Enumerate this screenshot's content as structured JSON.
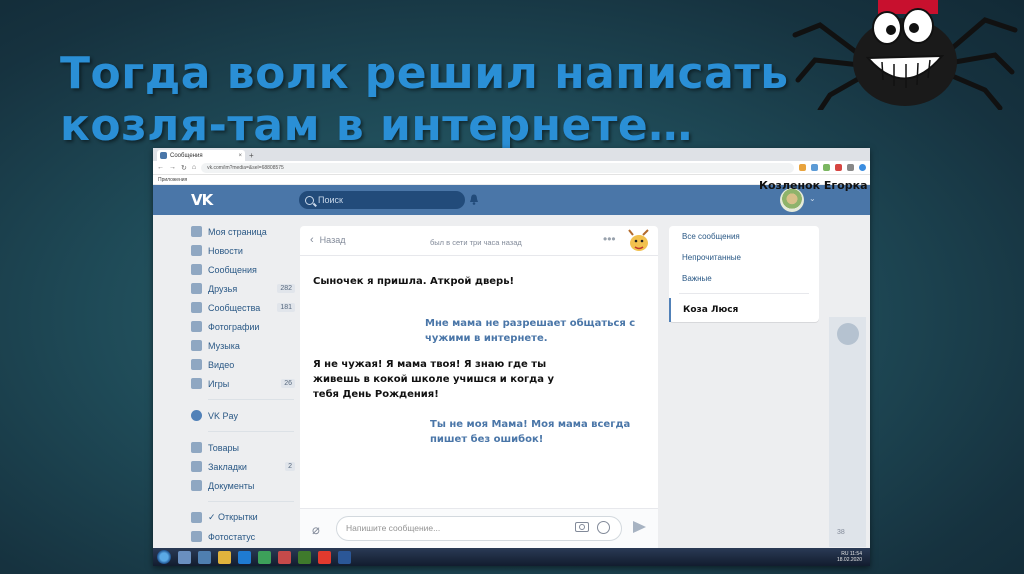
{
  "slide": {
    "title": "Тогда волк решил написать козля-там в интернете…"
  },
  "browser": {
    "tab_title": "Сообщения",
    "tab_close": "×",
    "new_tab": "+",
    "url": "vk.com/im?media=&sel=68808575",
    "bookmark": "Приложения"
  },
  "vk": {
    "logo": "VK",
    "search_placeholder": "Поиск",
    "user_name": "Козленок Егорка",
    "sidebar": [
      {
        "label": "Моя страница",
        "count": ""
      },
      {
        "label": "Новости",
        "count": ""
      },
      {
        "label": "Сообщения",
        "count": ""
      },
      {
        "label": "Друзья",
        "count": "282"
      },
      {
        "label": "Сообщества",
        "count": "181"
      },
      {
        "label": "Фотографии",
        "count": ""
      },
      {
        "label": "Музыка",
        "count": ""
      },
      {
        "label": "Видео",
        "count": ""
      },
      {
        "label": "Игры",
        "count": "26"
      }
    ],
    "sidebar_pay": {
      "label": "VK Pay"
    },
    "sidebar_extra": [
      {
        "label": "Товары",
        "count": ""
      },
      {
        "label": "Закладки",
        "count": "2"
      },
      {
        "label": "Документы",
        "count": ""
      }
    ],
    "sidebar_bottom": [
      {
        "label": "✓ Открытки"
      },
      {
        "label": "Фотостатус"
      }
    ],
    "chat": {
      "back_label": "Назад",
      "last_seen": "был в сети три часа назад",
      "more": "•••",
      "messages": [
        {
          "dir": "in",
          "text": "Сыночек я пришла.  Аткрой дверь!"
        },
        {
          "dir": "out",
          "text": "Мне мама не разрешает общаться с\nчужими в интернете."
        },
        {
          "dir": "in",
          "text": "Я не чужая! Я мама твоя! Я знаю где ты\nживешь в кокой школе учишся   и когда у\nтебя День Рождения!"
        },
        {
          "dir": "out",
          "text": "Ты не моя Мама! Моя мама всегда\nпишет без ошибок!"
        }
      ],
      "input_placeholder": "Напишите сообщение..."
    },
    "filters": {
      "items": [
        "Все сообщения",
        "Непрочитанные",
        "Важные"
      ],
      "active_contact": "Коза Люся"
    },
    "rail_count": "38"
  },
  "taskbar": {
    "lang": "RU",
    "time": "11:54",
    "date": "18.02.2020"
  },
  "colors": {
    "title": "#2a8fd6",
    "vk_header": "#4a76a8",
    "out_message": "#4a76a8"
  }
}
